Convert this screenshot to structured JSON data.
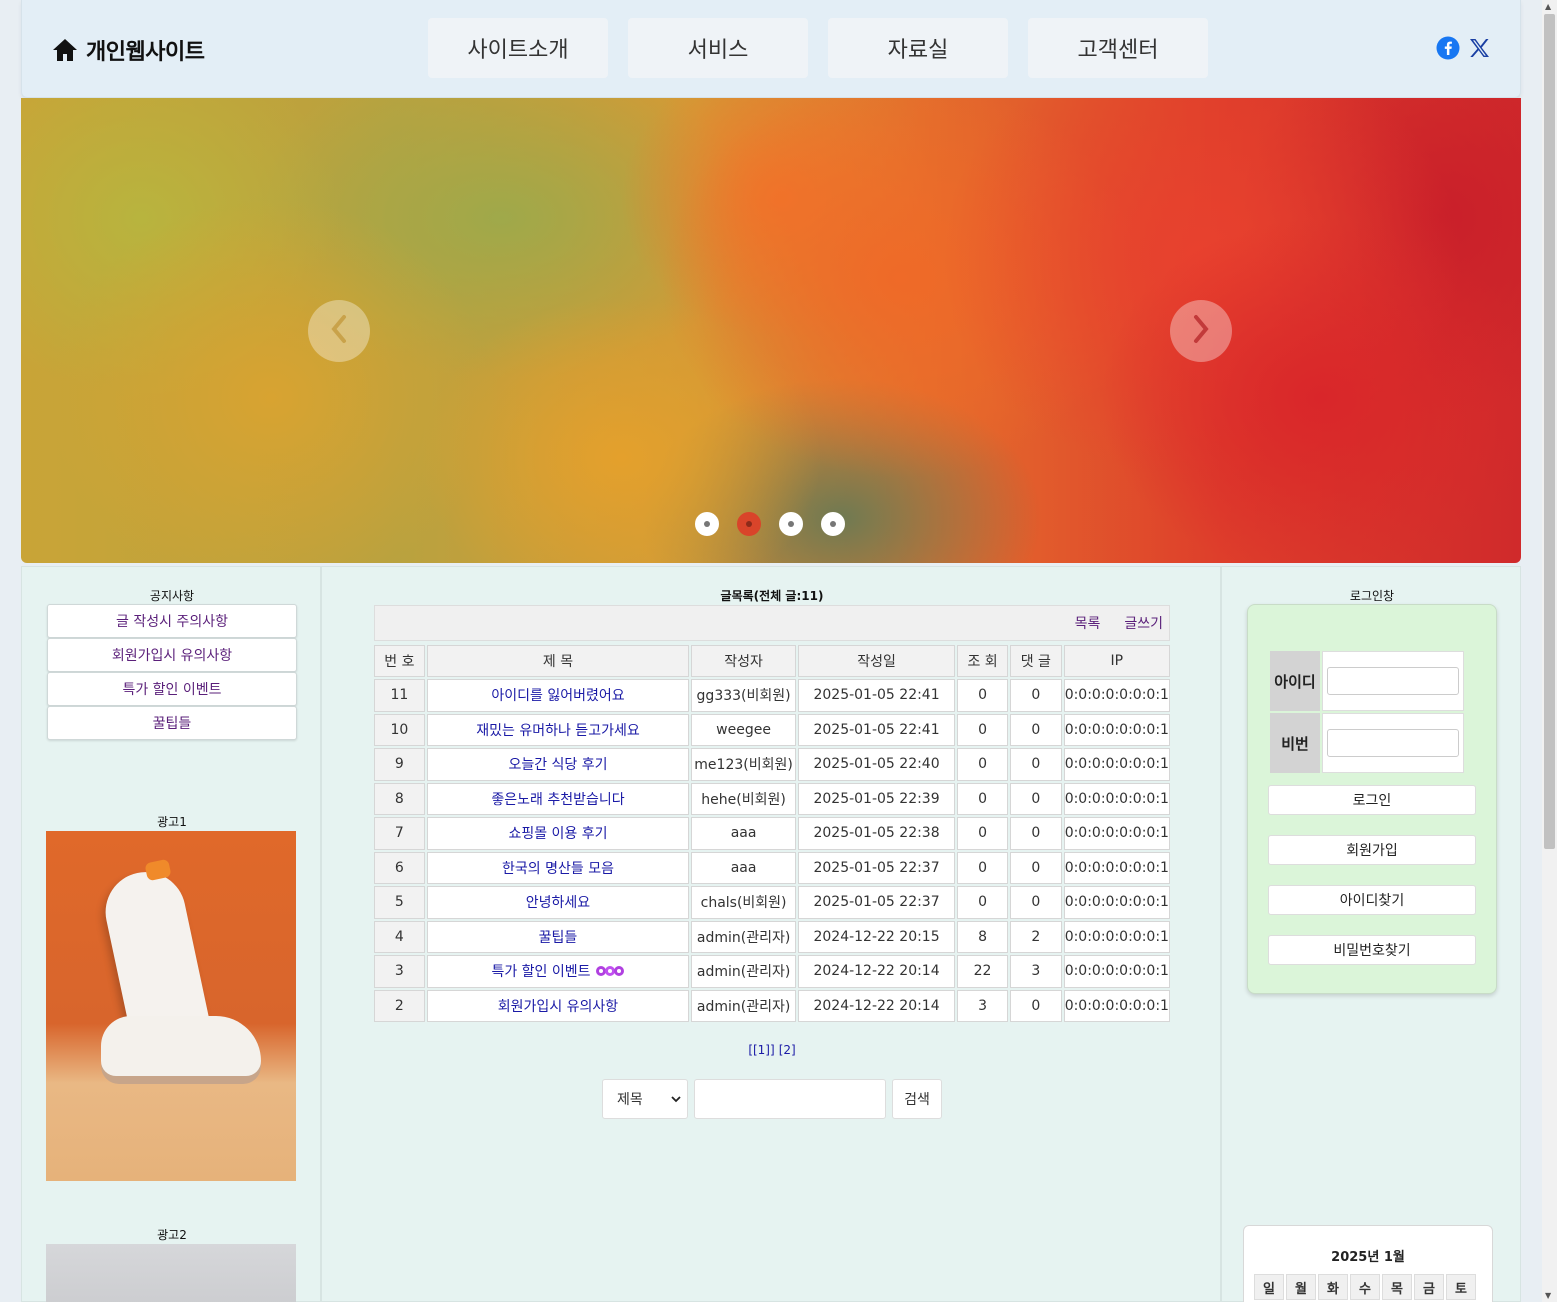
{
  "header": {
    "logo_text": "개인웹사이트",
    "nav": [
      "사이트소개",
      "서비스",
      "자료실",
      "고객센터"
    ]
  },
  "left": {
    "notice_title": "공지사항",
    "notices": [
      "글 작성시 주의사항",
      "회원가입시 유의사항",
      "특가 할인 이벤트",
      "꿀팁들"
    ],
    "ad1_title": "광고1",
    "ad2_title": "광고2"
  },
  "board": {
    "title": "글목록(전체 글:11)",
    "list_label": "목록",
    "write_label": "글쓰기",
    "columns": [
      "번 호",
      "제 목",
      "작성자",
      "작성일",
      "조 회",
      "댓 글",
      "IP"
    ],
    "rows": [
      {
        "no": "11",
        "subject": "아이디를 잃어버렸어요",
        "writer": "gg333(비회원)",
        "date": "2025-01-05 22:41",
        "views": "0",
        "comments": "0",
        "ip": "0:0:0:0:0:0:0:1"
      },
      {
        "no": "10",
        "subject": "재밌는 유머하나 듣고가세요",
        "writer": "weegee",
        "date": "2025-01-05 22:41",
        "views": "0",
        "comments": "0",
        "ip": "0:0:0:0:0:0:0:1"
      },
      {
        "no": "9",
        "subject": "오늘간 식당 후기",
        "writer": "me123(비회원)",
        "date": "2025-01-05 22:40",
        "views": "0",
        "comments": "0",
        "ip": "0:0:0:0:0:0:0:1"
      },
      {
        "no": "8",
        "subject": "좋은노래 추천받습니다",
        "writer": "hehe(비회원)",
        "date": "2025-01-05 22:39",
        "views": "0",
        "comments": "0",
        "ip": "0:0:0:0:0:0:0:1"
      },
      {
        "no": "7",
        "subject": "쇼핑몰 이용 후기",
        "writer": "aaa",
        "date": "2025-01-05 22:38",
        "views": "0",
        "comments": "0",
        "ip": "0:0:0:0:0:0:0:1"
      },
      {
        "no": "6",
        "subject": "한국의 명산들 모음",
        "writer": "aaa",
        "date": "2025-01-05 22:37",
        "views": "0",
        "comments": "0",
        "ip": "0:0:0:0:0:0:0:1"
      },
      {
        "no": "5",
        "subject": "안녕하세요",
        "writer": "chals(비회원)",
        "date": "2025-01-05 22:37",
        "views": "0",
        "comments": "0",
        "ip": "0:0:0:0:0:0:0:1"
      },
      {
        "no": "4",
        "subject": "꿀팁들",
        "writer": "admin(관리자)",
        "date": "2024-12-22 20:15",
        "views": "8",
        "comments": "2",
        "ip": "0:0:0:0:0:0:0:1"
      },
      {
        "no": "3",
        "subject": "특가 할인 이벤트",
        "writer": "admin(관리자)",
        "date": "2024-12-22 20:14",
        "views": "22",
        "comments": "3",
        "ip": "0:0:0:0:0:0:0:1",
        "hot": true
      },
      {
        "no": "2",
        "subject": "회원가입시 유의사항",
        "writer": "admin(관리자)",
        "date": "2024-12-22 20:14",
        "views": "3",
        "comments": "0",
        "ip": "0:0:0:0:0:0:0:1"
      }
    ],
    "pages": [
      "[[1]]",
      "[2]"
    ],
    "search_field": "제목",
    "search_button": "검색"
  },
  "right": {
    "login_title": "로그인창",
    "id_label": "아이디",
    "pw_label": "비번",
    "login_button": "로그인",
    "join_button": "회원가입",
    "find_id_button": "아이디찾기",
    "find_pw_button": "비밀번호찾기",
    "calendar_title": "2025년 1월",
    "weekdays": [
      "일",
      "월",
      "화",
      "수",
      "목",
      "금",
      "토"
    ]
  },
  "slider": {
    "dot_count": 4,
    "active_dot": 2
  },
  "colors": {
    "header_bg": "#e3eef6",
    "column_bg": "#e6f3f1",
    "login_bg": "#dbf5d9",
    "link_purple": "#5a1f7a",
    "link_blue": "#1a1aa6",
    "facebook": "#1877f2"
  }
}
